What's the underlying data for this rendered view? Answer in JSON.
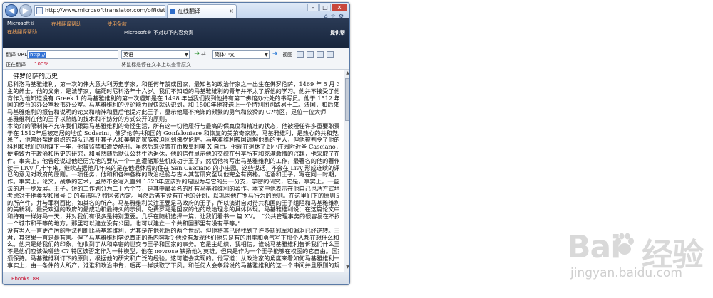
{
  "browser": {
    "address": "http://www.microsofttranslator.com/officetran",
    "tab_title": "在线翻译",
    "tab_close": "×",
    "window_controls": [
      "–",
      "□",
      "✕"
    ],
    "toolbar_icons": [
      "home-icon",
      "star-icon",
      "gear-icon"
    ]
  },
  "header": {
    "brand": "Microsoft®",
    "nav_items": [
      "在线翻译帮助",
      "使用条款"
    ],
    "sub_title": "在线翻译帮助",
    "middle_text": "Microsoft® 不对以下内容负责",
    "right_text": "提供帮"
  },
  "toolbar": {
    "translate_label": "翻译 URL",
    "url_value": "http://",
    "from_lang": "英语",
    "to_lang": "简体中文",
    "view_label": "视图",
    "status_label": "正在翻译",
    "status_percent": "100%",
    "hint": "将鼠标悬停在文本上以查看原文"
  },
  "document": {
    "title": "佛罗伦萨的历史",
    "paragraphs": [
      "尼科洛马基雅维利，第一次的伟大意大利历史学家，和任何年龄或国家，最知名的政治作家之一出生在佛罗伦萨，1469 年 5 月 3。他的",
      "主的绅士，他的父亲，是法学家，临死时尼科洛年十六岁。我们不知道的马基雅维利的青年并不太了解他的学习。他并不接受了他的",
      "育作为他知道没有 Greek.1 的马基雅维利的第一次遇知是在 1498 年当我们找到他持有第二佛馆办公处的书写员。他于 1512 年保留着",
      "国的传台的办公室秋书办公室。马基雅维利的评论能力很快就认识到，和 1500年他被送上一个特别团别路易十二。法国，和后来在大使馆到 C?特区",
      "马基雅维利的报告和说明的论文和精神和显后他提对此王子，显示他毫不掩饰的频繁的勇气和狡猾的 C?特区，是位一位大师",
      "基雅维利在他的王子以熟练的技术和不妨分的方式公开的原则。",
      "本简介的限制将不允许我们跟踪马基雅维利的奇怪生活，所有这一切他履行与最高的保真度和精准的状态，他被授任许多重要职责。利",
      "于在 1512年后被定居的地位 Soderini，佛罗伦萨共和国的 Gonfaloniere 和恢复的美第奇家族。马基雅维利，是热心的共和党人，的努力共",
      "患了，他曾经帮助组织的部队迅离开其子人和美第奇家族被迫回到佛罗伦萨。马基雅维利被国调解他断的主人，但他被判令了他的办公室",
      "科利和我们的阴谋下一年，他被监禁和遭受酷刑，虽然后来设置在由教皇利奥 X 自由。他现在退休了到小庄园附近圣 Casciano，从佛罗伦萨",
      "便能致力于政治和历史的研究，和虽然随后默认公共生活退休，他的信件显示他的交织在分享所有和充满激情的兴趣，他采取了在意大利，然后经过，政治",
      "件。事实上，他曾经说过他经历完他的要从一个一直遭储那些机成功于王子，然后他将写出马基雅维利的工作，最著名的他的著作，并在这里还他已开始广泛搜的要",
      "读于 Livy 几十年来，继续占据他几年来的是在他退休后的住在 San Casciano 的小庄园。这些说话，不会在 Livy 形成连续的评注，马基雅维利",
      "已的意见对政府的原则。一项任务，他和和各种各样的政治经验与古人其苦研究至现他完全有资格。话语和王子，写在同一时期，互相相",
      "作。事实上，论文，战争的艺术，虽然不会写入直到 1520年应该算的是因为与它的另一分支，学密的研究，它是，事实上，一些在演讲",
      "法的进一步发展。王子，短的工作划分为二十六个节，是其中最著名的所有马基雅维利的著作。本文中他表示在他自己也活方式地对建立",
      "考虑对于他类型和图号 C 的看法吗? 特区该否定。虽然后者有没有在他的计划，以巩固他在罗马行为的原则。在这里们下的原则是时间的他的",
      "的所产件，并与菲利西比，如其名的所产。马基雅维利关注王要是马政府的王子，所以演讲自对待共和国的王子组阻和马基雅维利模型共和",
      "的美新利，最受欢迎的政府的最成功和最持久的示例。免费罗马是国家的他的政治理念的具体体现。马基雅维利说：在这篇论文中的多",
      "和持有一样好马一天，并对我们有很多是特别重要。几乎在随机选择一篇，让我们看书一 篇 XV。：“公共管理事务的很容易在不损坏",
      "一个城市和平等的地方，那里可以建立没有公国，也可以建立一个共和国那里有没有平等。”",
      "没有男人一直更严厉的手法判断比马基雅维利，尤其是在他死后的两个世纪。但他将其已经找到了许多新冠军和漏洞已经逆转。王子被视",
      "君，其效果一直是最有害。但了马基雅维利学说真正的新内容呢? 他没有发现他们他只是有的用率和勇气写下那个人都在想什么和他们",
      "么。他只是给我们的印象，他收到了从和幸密的世交与王子和国家的事务。它是主组织，我相信，谁说马基雅维利告诉我们什么王子们",
      "不是他们应该做哪些 C? 特区该否定作为一种模型，他在 novrose 铁扬他为英雄。但只是作为一个王子能够在权图的它自由。国家的主是",
      "须保持。马基雅维利订下的原则，根据他的研究和广泛的经验，这可能会实现的。他写道：从政治家的角度来看如何马基雅维利一个",
      "事实上，由一条件的人所产，谁谁和政治中肯，后再一样获取了下风。和任何人会争辩说的马基雅维利的这一个中间并且原则的规"
    ],
    "link_text": "Ebooks188"
  },
  "watermark": {
    "brand_left": "Bai",
    "brand_right": "经验",
    "url": "jingyan.baidu.com"
  }
}
